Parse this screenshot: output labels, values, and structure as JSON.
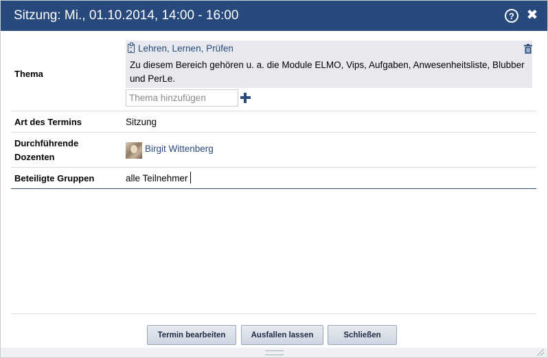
{
  "dialog": {
    "title": "Sitzung: Mi., 01.10.2014, 14:00 - 16:00",
    "help_icon": "?",
    "close_icon": "✖"
  },
  "fields": {
    "thema": {
      "label": "Thema",
      "topic_title": "Lehren, Lernen, Prüfen",
      "topic_description": "Zu diesem Bereich gehören u. a. die Module ELMO, Vips, Aufgaben, Anwesenheitsliste, Blubber und PerLe.",
      "input_placeholder": "Thema hinzufügen",
      "input_value": ""
    },
    "art": {
      "label": "Art des Termins",
      "value": "Sitzung"
    },
    "dozenten": {
      "label_line1": "Durchführende",
      "label_line2": "Dozenten",
      "person": "Birgit Wittenberg"
    },
    "gruppen": {
      "label": "Beteiligte Gruppen",
      "value": "alle Teilnehmer"
    }
  },
  "buttons": {
    "edit": "Termin bearbeiten",
    "cancel_event": "Ausfallen lassen",
    "close": "Schließen"
  },
  "icons": {
    "help": "help-icon",
    "close": "close-icon",
    "topic": "clipboard-icon",
    "delete": "trash-icon",
    "add": "plus-icon",
    "avatar": "avatar-image"
  },
  "colors": {
    "titlebar": "#28497c",
    "link": "#28497c",
    "topic_box": "#e7e9ee"
  }
}
